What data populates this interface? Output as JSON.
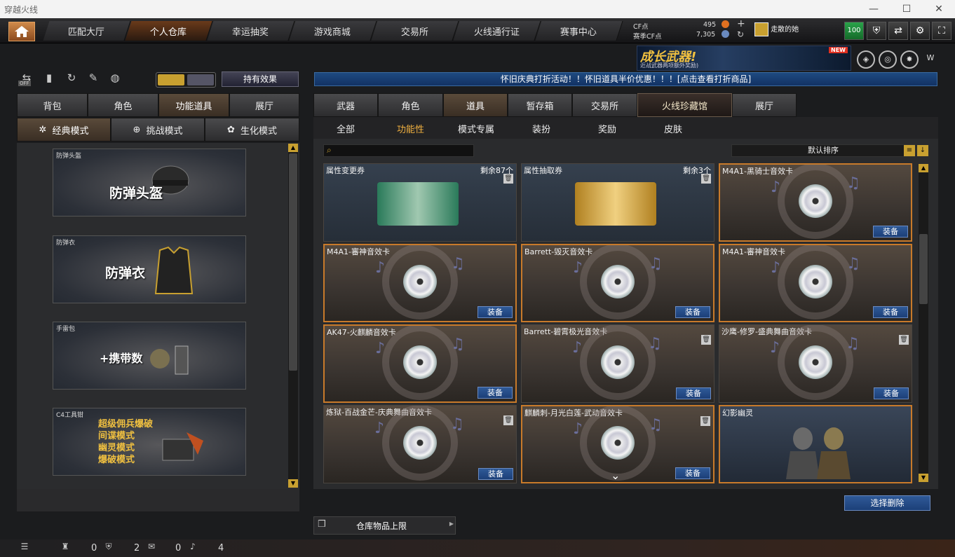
{
  "window": {
    "title": "穿越火线"
  },
  "nav": {
    "tabs": [
      "匹配大厅",
      "个人仓库",
      "幸运抽奖",
      "游戏商城",
      "交易所",
      "火线通行证",
      "赛事中心"
    ],
    "active": 1
  },
  "currency": {
    "cf_label": "CF点",
    "cf_value": "495",
    "event_label": "赛季CF点",
    "event_value": "7,305"
  },
  "player": {
    "name": "走散的她",
    "level": "100"
  },
  "banner": {
    "title": "成长武器!",
    "subtitle": "近战武器两项额外奖励)",
    "tag": "NEW"
  },
  "notice": "怀旧庆典打折活动！！怀旧道具半价优惠！！！[点击查看打折商品]",
  "left": {
    "toggle": "OFF",
    "effects_button": "持有效果",
    "tabs": [
      "背包",
      "角色",
      "功能道具",
      "展厅"
    ],
    "modes": [
      "经典模式",
      "挑战模式",
      "生化模式"
    ],
    "cards": [
      {
        "caption": "防弹头盔",
        "label": "防弹头盔"
      },
      {
        "caption": "防弹衣",
        "label": "防弹衣"
      },
      {
        "caption": "手雷包",
        "label": "+携带数"
      },
      {
        "caption": "C4工具钳",
        "lines": [
          "超级佣兵爆破",
          "间谍模式",
          "幽灵模式",
          "爆破模式"
        ]
      }
    ]
  },
  "right": {
    "tabs": [
      "武器",
      "角色",
      "道具",
      "暂存箱",
      "交易所",
      "火线珍藏馆",
      "展厅"
    ],
    "subtabs": [
      "全部",
      "功能性",
      "模式专属",
      "装扮",
      "奖励",
      "皮肤"
    ],
    "sort": "默认排序",
    "equip_label": "装备",
    "items": [
      {
        "title": "属性变更券",
        "count": "剩余87个"
      },
      {
        "title": "属性抽取券",
        "count": "剩余3个"
      },
      {
        "title": "M4A1-黑骑士音效卡"
      },
      {
        "title": "M4A1-審神音效卡"
      },
      {
        "title": "Barrett-毁灭音效卡"
      },
      {
        "title": "M4A1-審神音效卡"
      },
      {
        "title": "AK47-火麒麟音效卡"
      },
      {
        "title": "Barrett-碧霄极光音效卡"
      },
      {
        "title": "沙鹰-修罗-盛典舞曲音效卡"
      },
      {
        "title": "炼狱-百战金芒-庆典舞曲音效卡"
      },
      {
        "title": "麒麟刺-月光白莲-武动音效卡"
      },
      {
        "title": "幻影幽灵"
      }
    ],
    "delete_button": "选择删除",
    "capacity_label": "仓库物品上限"
  },
  "status": {
    "c1": "0",
    "c2": "2",
    "c3": "0",
    "c4": "4"
  }
}
